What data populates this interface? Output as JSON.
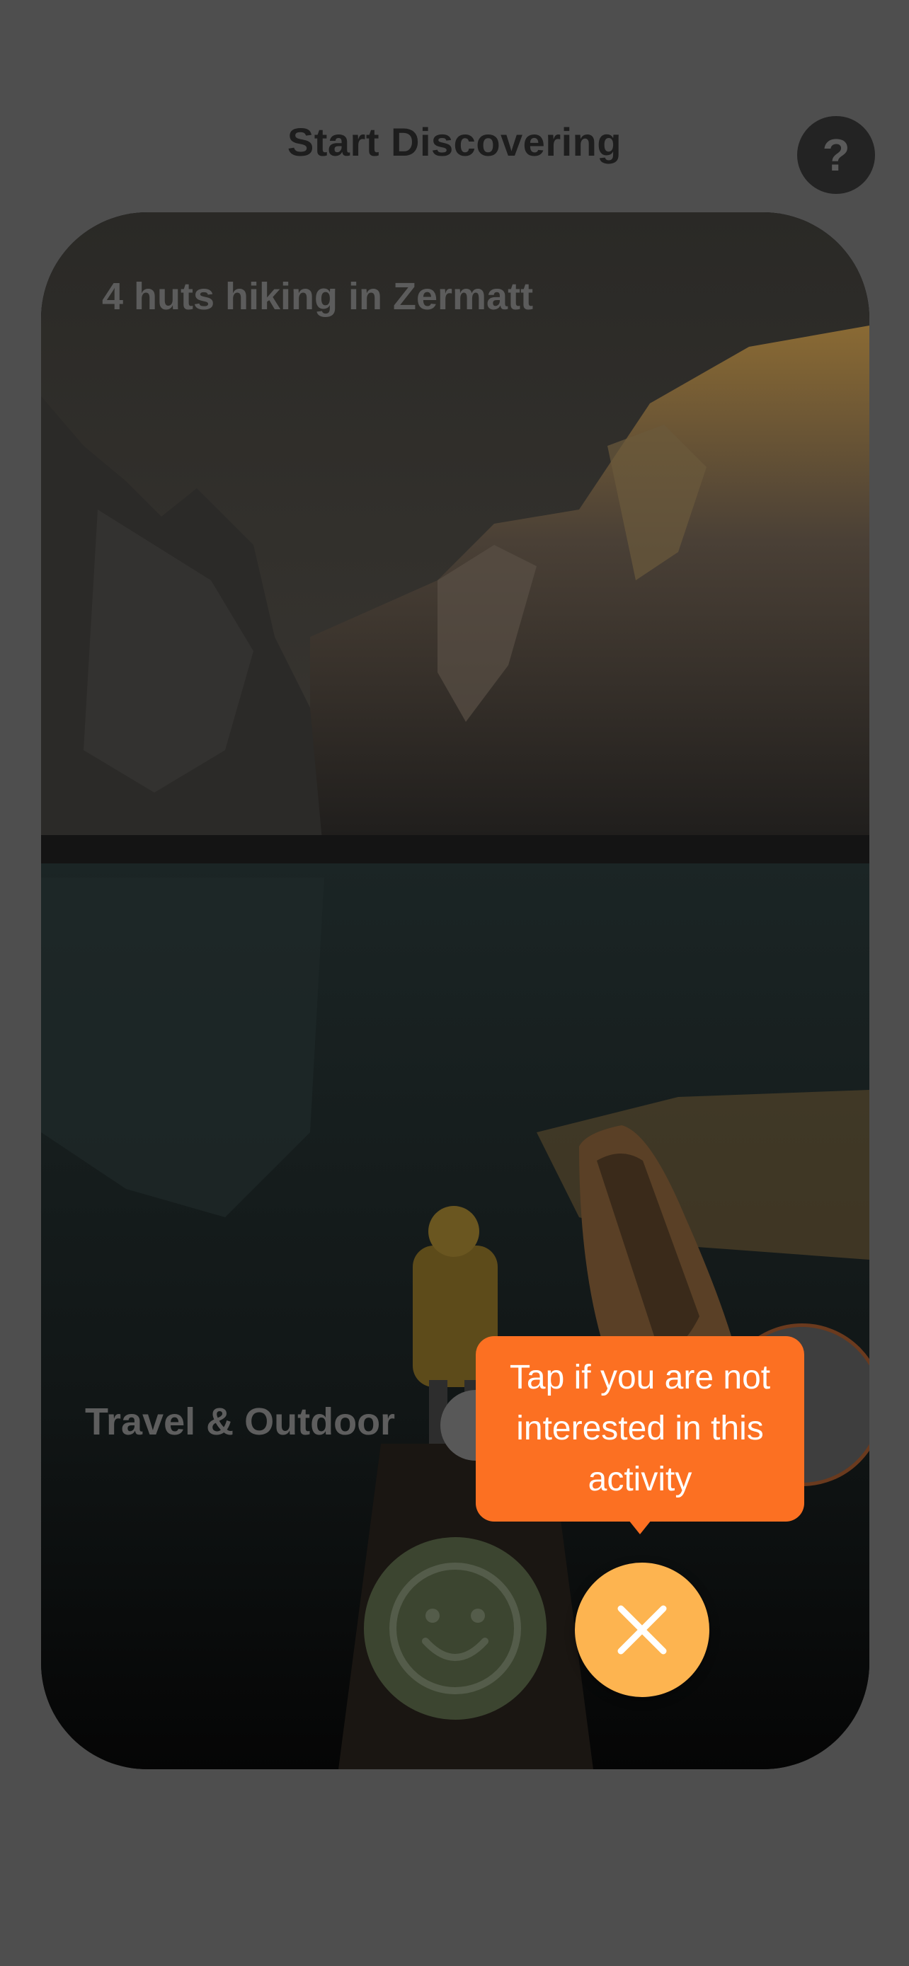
{
  "header": {
    "title": "Start Discovering",
    "help_label": "?"
  },
  "card": {
    "title": "4 huts hiking in Zermatt",
    "category": "Travel & Outdoor",
    "image_description_icon": "mountain-lake-photo"
  },
  "actions": {
    "like_icon": "smiley-icon",
    "dislike_icon": "close-icon"
  },
  "tooltip": {
    "text": "Tap if you are not interested in this activity"
  },
  "colors": {
    "accent_orange": "#fc7022",
    "dislike_yellow": "#fdb450",
    "overlay_gray": "#4e4e4e"
  }
}
